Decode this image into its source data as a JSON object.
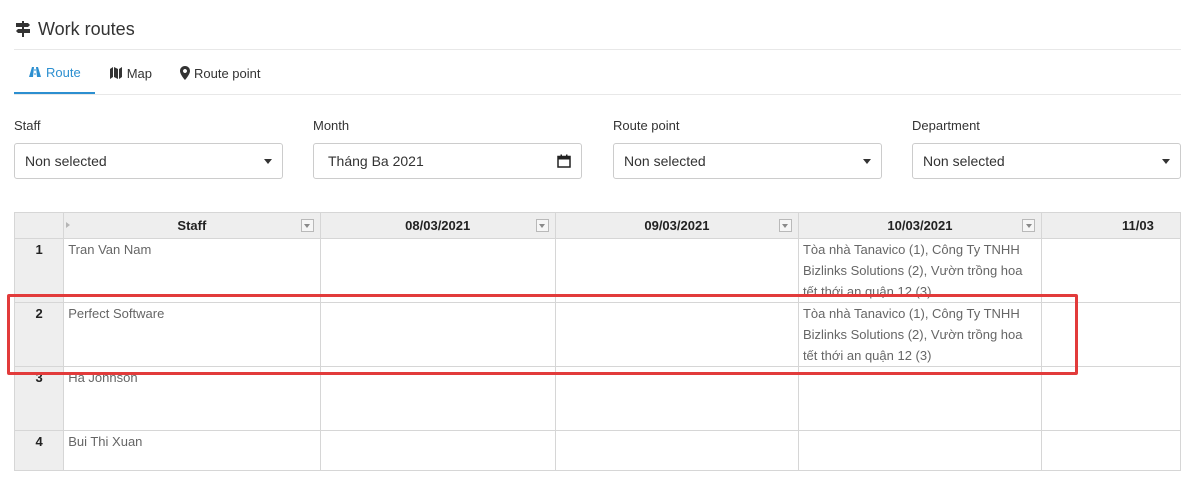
{
  "page": {
    "title": "Work routes",
    "title_icon": "signpost-icon"
  },
  "tabs": [
    {
      "label": "Route",
      "icon": "road-icon",
      "active": true
    },
    {
      "label": "Map",
      "icon": "map-icon",
      "active": false
    },
    {
      "label": "Route point",
      "icon": "map-marker-icon",
      "active": false
    }
  ],
  "filters": {
    "staff": {
      "label": "Staff",
      "value": "Non selected"
    },
    "month": {
      "label": "Month",
      "value": "Tháng Ba  2021"
    },
    "route_point": {
      "label": "Route point",
      "value": "Non selected"
    },
    "department": {
      "label": "Department",
      "value": "Non selected"
    }
  },
  "grid": {
    "columns": [
      "Staff",
      "08/03/2021",
      "09/03/2021",
      "10/03/2021",
      "11/03"
    ],
    "rows": [
      {
        "num": "1",
        "staff": "Tran Van Nam",
        "d0803": "",
        "d0903": "",
        "d1003": "Tòa nhà Tanavico (1), Công Ty TNHH Bizlinks Solutions (2), Vườn trồng hoa tết thới an quận 12 (3)",
        "d1103": ""
      },
      {
        "num": "2",
        "staff": "Perfect Software",
        "d0803": "",
        "d0903": "",
        "d1003": "Tòa nhà Tanavico (1), Công Ty TNHH Bizlinks Solutions (2), Vườn trồng hoa tết thới an quận 12 (3)",
        "d1103": ""
      },
      {
        "num": "3",
        "staff": "Ha Johnson",
        "d0803": "",
        "d0903": "",
        "d1003": "",
        "d1103": ""
      },
      {
        "num": "4",
        "staff": "Bui Thi Xuan",
        "d0803": "",
        "d0903": "",
        "d1003": "",
        "d1103": ""
      }
    ]
  },
  "colors": {
    "accent": "#2c8fd0",
    "highlight": "#e23b3b",
    "header_bg": "#eeeeee"
  }
}
